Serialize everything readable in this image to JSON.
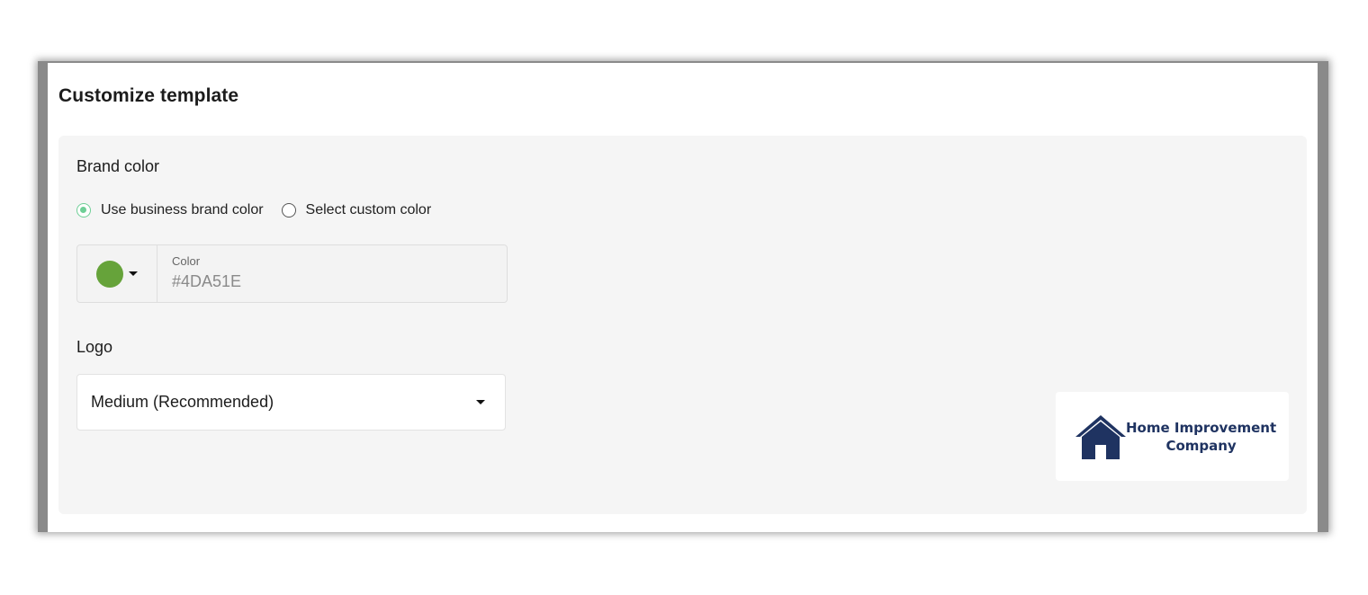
{
  "card": {
    "title": "Customize template"
  },
  "brand_color": {
    "label": "Brand color",
    "options": [
      {
        "label": "Use business brand color",
        "selected": true
      },
      {
        "label": "Select custom color",
        "selected": false
      }
    ],
    "color_field_label": "Color",
    "color_value": "#4DA51E",
    "swatch_hex": "#66a33a"
  },
  "logo": {
    "label": "Logo",
    "size_selected": "Medium (Recommended)",
    "preview_line1": "Home Improvement",
    "preview_line2": "Company"
  },
  "colors": {
    "radio_accent": "#6fcf97",
    "logo_navy": "#1f3361",
    "panel_bg": "#f5f5f5"
  }
}
